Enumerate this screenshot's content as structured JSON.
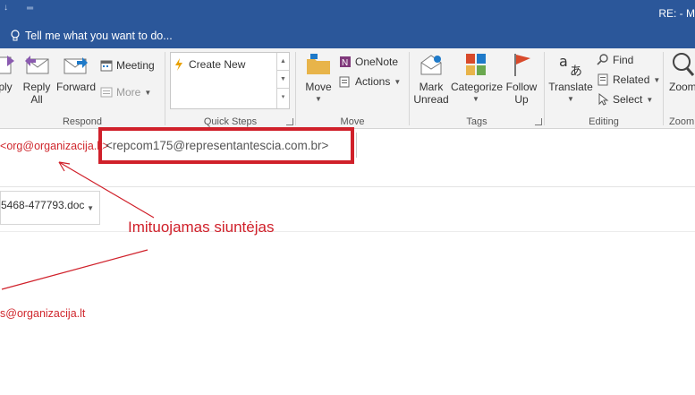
{
  "window": {
    "title": "RE:  - M",
    "tell_me": "Tell me what you want to do..."
  },
  "ribbon": {
    "respond": {
      "label": "Respond",
      "reply_all_partial": "ply",
      "reply_all_label": "Reply All",
      "forward_label": "Forward",
      "meeting_label": "Meeting",
      "more_label": "More"
    },
    "quick_steps": {
      "label": "Quick Steps",
      "create_new": "Create New"
    },
    "move": {
      "label": "Move",
      "move_button": "Move",
      "onenote": "OneNote",
      "actions": "Actions"
    },
    "tags": {
      "label": "Tags",
      "mark_unread": "Mark Unread",
      "categorize": "Categorize",
      "follow_up": "Follow Up"
    },
    "editing": {
      "label": "Editing",
      "translate": "Translate",
      "find": "Find",
      "related": "Related",
      "select": "Select"
    },
    "zoom": {
      "label": "Zoom",
      "zoom_button": "Zoom"
    }
  },
  "message": {
    "from_display": "<org@organizacija.lt>",
    "from_visible": "org@organizacija.lt",
    "real_sender": "<repcom175@representantescia.com.br>",
    "attachment": "5468-477793.doc",
    "to_display": "s@organizacija.lt"
  },
  "annotation": {
    "label": "Imituojamas siuntėjas"
  },
  "colors": {
    "title_bar": "#2b579a",
    "ribbon_bg": "#f3f3f3",
    "highlight": "#d0202a"
  }
}
